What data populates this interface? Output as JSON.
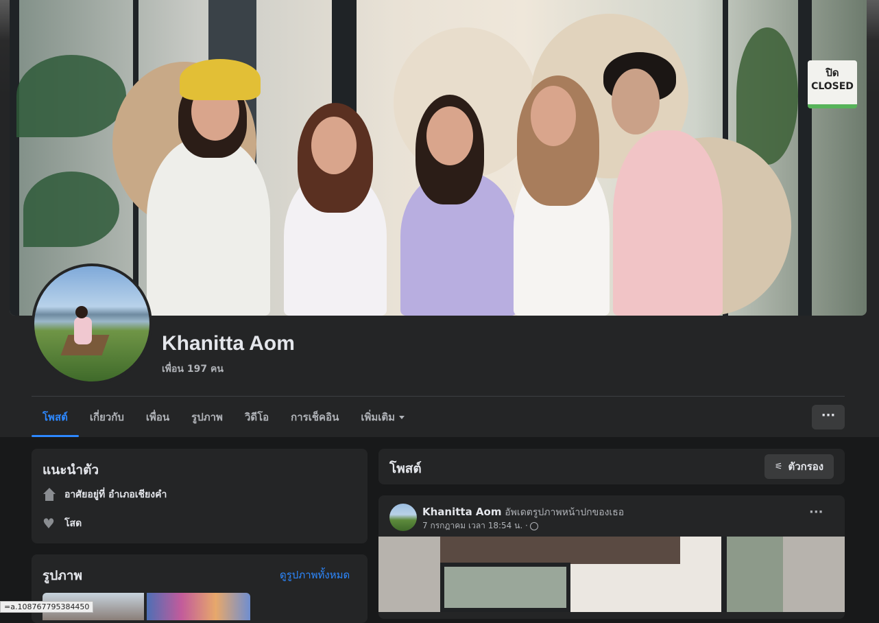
{
  "cover_sign": {
    "line1": "ปิด",
    "line2": "CLOSED"
  },
  "profile": {
    "name": "Khanitta Aom",
    "friends": "เพื่อน 197 คน"
  },
  "tabs": [
    {
      "label": "โพสต์",
      "active": true
    },
    {
      "label": "เกี่ยวกับ",
      "active": false
    },
    {
      "label": "เพื่อน",
      "active": false
    },
    {
      "label": "รูปภาพ",
      "active": false
    },
    {
      "label": "วิดีโอ",
      "active": false
    },
    {
      "label": "การเช็คอิน",
      "active": false
    },
    {
      "label": "เพิ่มเติม",
      "active": false
    }
  ],
  "more_button": {
    "label": "···"
  },
  "intro": {
    "title": "แนะนำตัว",
    "lives_in": "อาศัยอยู่ที่ อำเภอเชียงคำ",
    "relationship": "โสด"
  },
  "photos": {
    "title": "รูปภาพ",
    "see_all": "ดูรูปภาพทั้งหมด"
  },
  "posts": {
    "title": "โพสต์",
    "filter_label": "ตัวกรอง"
  },
  "post": {
    "author": "Khanitta Aom",
    "action": "อัพเดตรูปภาพหน้าปกของเธอ",
    "time": "7 กรกฎาคม เวลา 18:54 น. ·",
    "more": "···"
  },
  "status_bar": {
    "url": "=a.108767795384450"
  },
  "colors": {
    "accent": "#2d88ff",
    "background": "#18191a",
    "card": "#242526"
  }
}
